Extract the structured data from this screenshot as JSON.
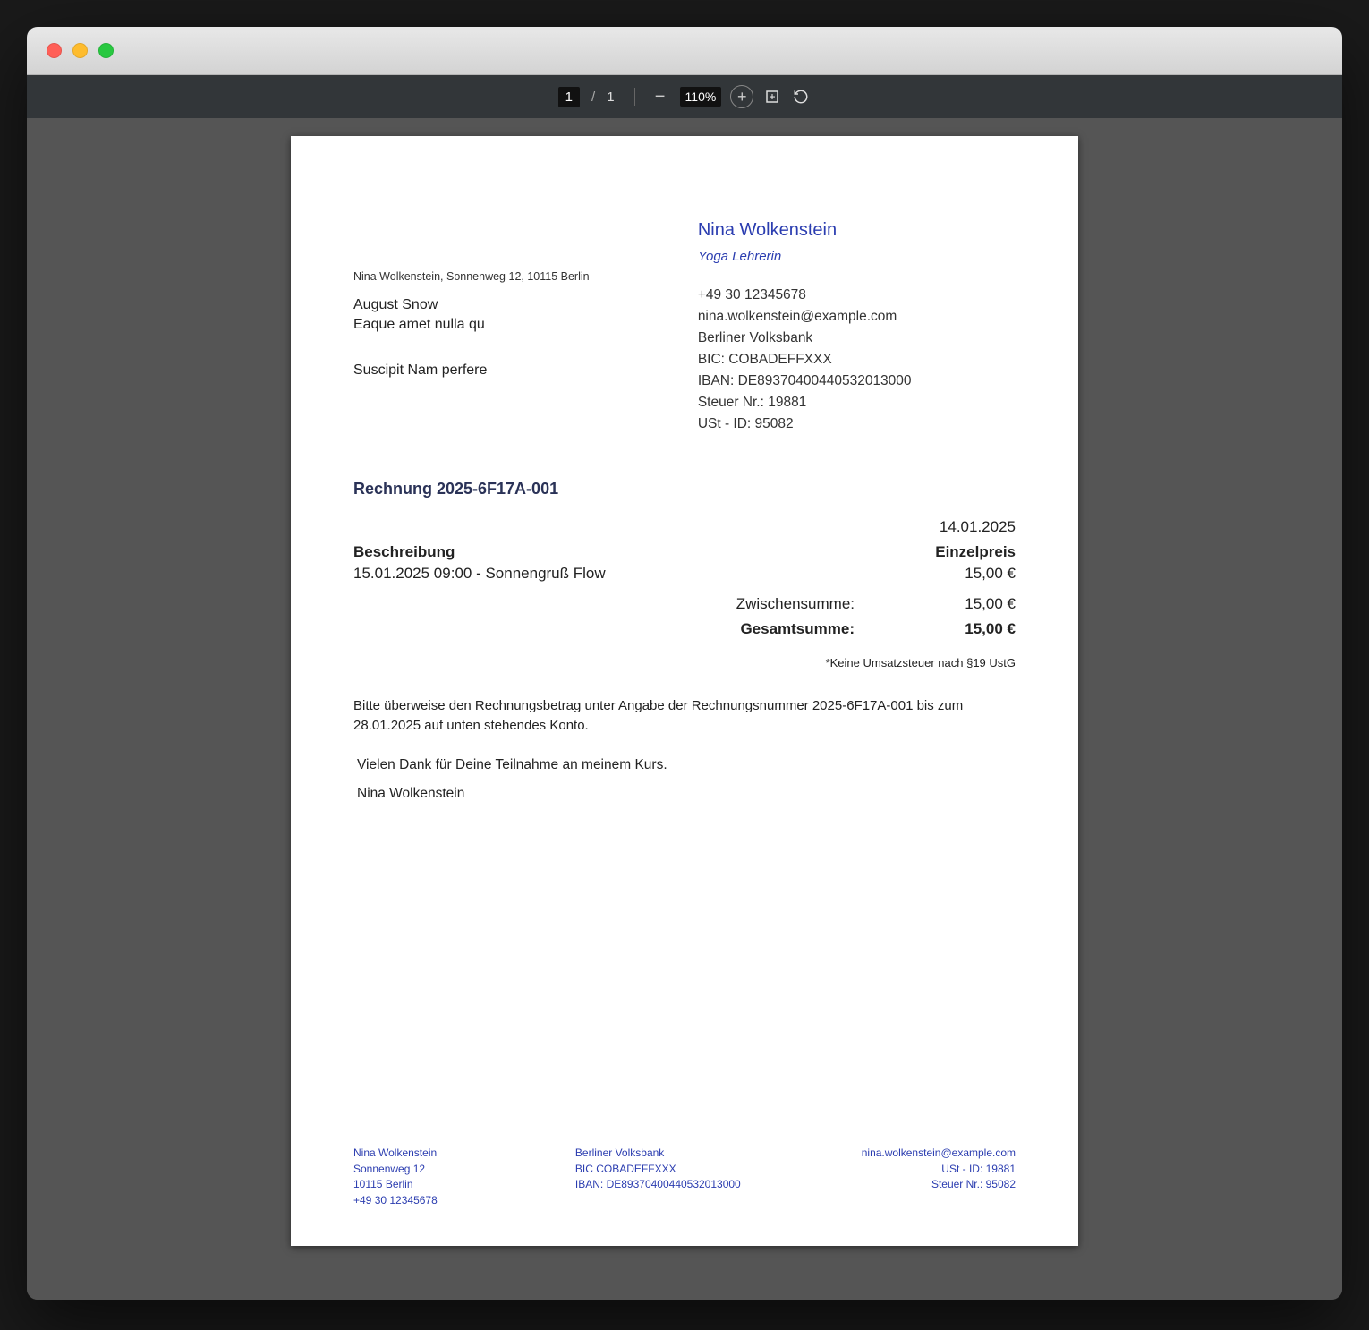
{
  "viewer": {
    "current_page": "1",
    "total_pages": "1",
    "zoom_level": "110%"
  },
  "sender": {
    "name": "Nina Wolkenstein",
    "subtitle": "Yoga Lehrerin",
    "address_line": "Nina Wolkenstein, Sonnenweg 12, 10115 Berlin",
    "phone": "+49 30 12345678",
    "email": "nina.wolkenstein@example.com",
    "bank": "Berliner Volksbank",
    "bic": "BIC: COBADEFFXXX",
    "iban": "IBAN: DE89370400440532013000",
    "steuer_nr": "Steuer Nr.: 19881",
    "ust_id": "USt - ID: 95082"
  },
  "recipient": {
    "line1": "August Snow",
    "line2": "Eaque amet nulla qu"
  },
  "subject": "Suscipit Nam perfere",
  "invoice": {
    "title": "Rechnung 2025-6F17A-001",
    "date": "14.01.2025",
    "col_desc_label": "Beschreibung",
    "col_price_label": "Einzelpreis",
    "item_desc": "15.01.2025 09:00 - Sonnengruß Flow",
    "item_price": "15,00 €",
    "subtotal_label": "Zwischensumme:",
    "subtotal_value": "15,00 €",
    "total_label": "Gesamtsumme:",
    "total_value": "15,00 €",
    "tax_note": "*Keine Umsatzsteuer nach §19 UstG",
    "payment_text": "Bitte überweise den Rechnungsbetrag unter Angabe der Rechnungsnummer 2025-6F17A-001 bis zum 28.01.2025 auf unten stehendes Konto.",
    "thanks": "Vielen Dank für Deine Teilnahme an meinem Kurs.",
    "signature": "Nina Wolkenstein"
  },
  "footer": {
    "left": {
      "l1": "Nina Wolkenstein",
      "l2": "Sonnenweg 12",
      "l3": "10115 Berlin",
      "l4": "+49 30 12345678"
    },
    "mid": {
      "l1": "Berliner Volksbank",
      "l2": "BIC COBADEFFXXX",
      "l3": "IBAN: DE89370400440532013000"
    },
    "right": {
      "l1": "nina.wolkenstein@example.com",
      "l2": "USt - ID: 19881",
      "l3": "Steuer Nr.: 95082"
    }
  }
}
